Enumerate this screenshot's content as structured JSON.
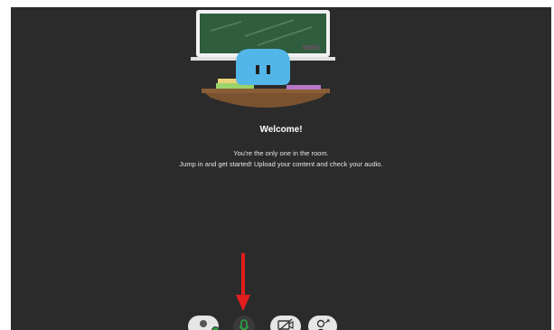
{
  "welcome": {
    "title": "Welcome!",
    "line1": "You're the only one in the room.",
    "line2": "Jump in and get started! Upload your content and check your audio."
  },
  "colors": {
    "background": "#2b2b2b",
    "annotation_arrow": "#e11d1d",
    "audio_icon": "#2ea043"
  },
  "controls": {
    "avatar_icon": "user-avatar-icon",
    "audio_icon": "microphone-icon",
    "video_icon": "camera-off-icon",
    "share_icon": "share-content-icon"
  }
}
